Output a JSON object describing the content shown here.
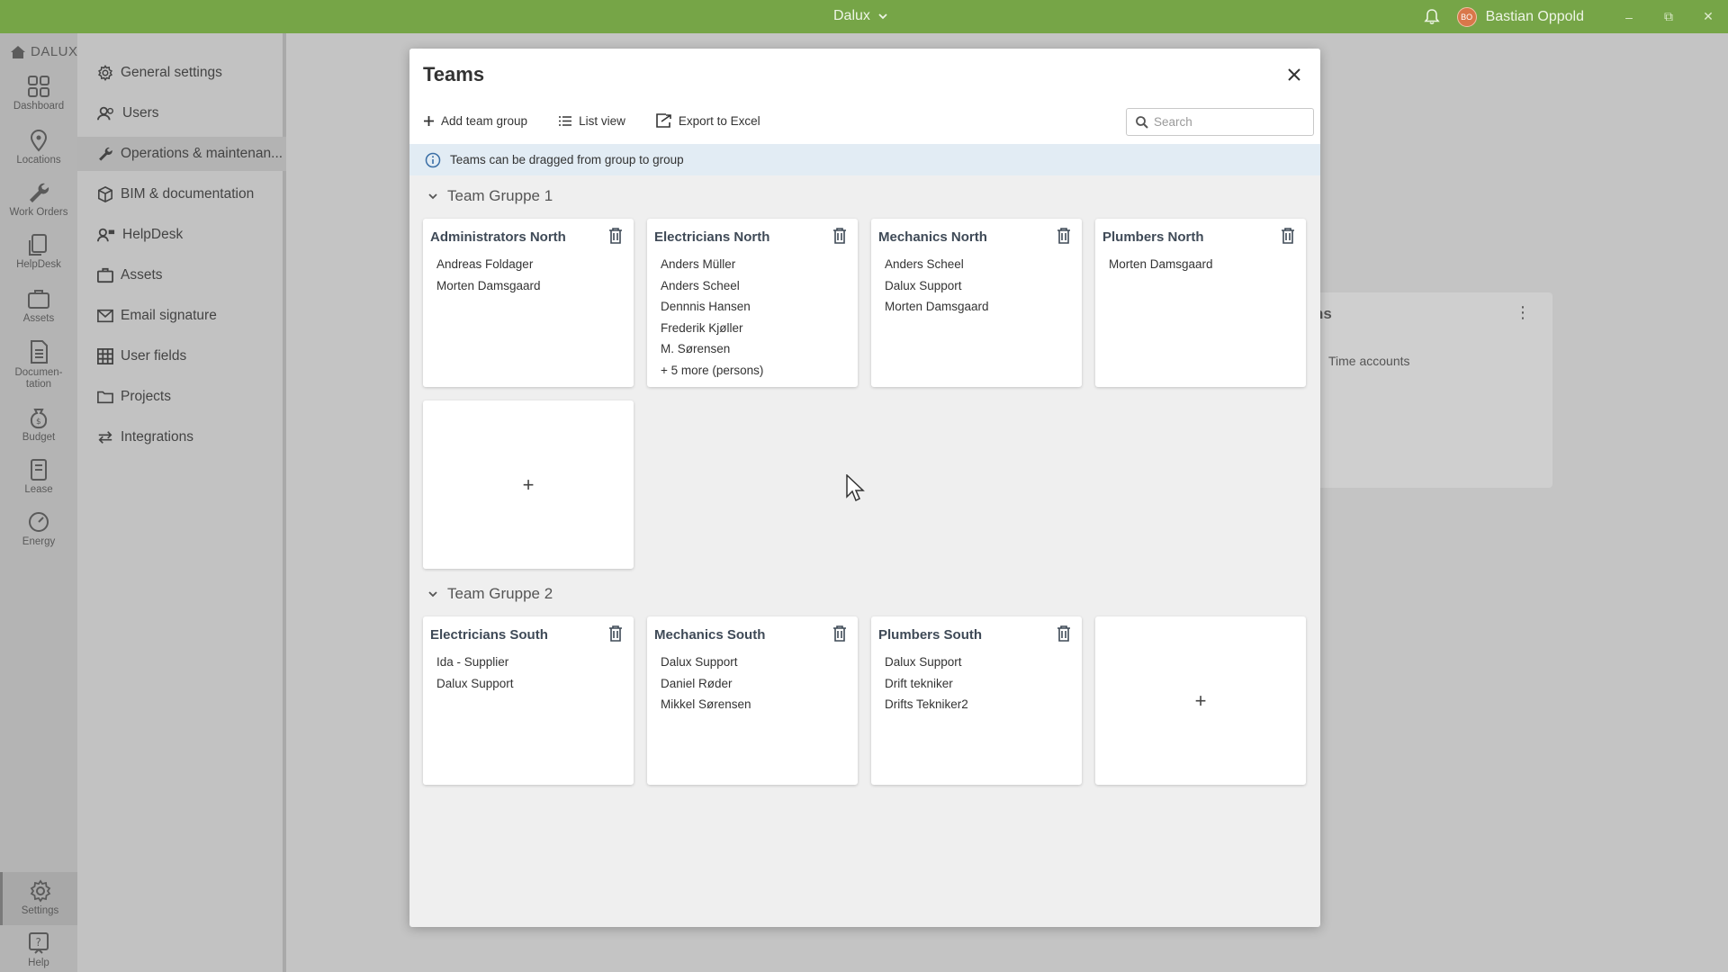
{
  "titlebar": {
    "app_name": "Dalux",
    "user_initials": "BO",
    "user_name": "Bastian Oppold"
  },
  "rail": {
    "logo_text": "DALUX",
    "items": [
      {
        "label": "Dashboard",
        "icon": "dashboard-icon"
      },
      {
        "label": "Locations",
        "icon": "location-pin-icon"
      },
      {
        "label": "Work Orders",
        "icon": "wrench-icon"
      },
      {
        "label": "HelpDesk",
        "icon": "helpdesk-icon"
      },
      {
        "label": "Assets",
        "icon": "assets-icon"
      },
      {
        "label": "Documen-\ntation",
        "icon": "document-icon"
      },
      {
        "label": "Budget",
        "icon": "money-bag-icon"
      },
      {
        "label": "Lease",
        "icon": "lease-icon"
      },
      {
        "label": "Energy",
        "icon": "gauge-icon"
      },
      {
        "label": "Settings",
        "icon": "gear-icon"
      },
      {
        "label": "Help",
        "icon": "help-icon"
      }
    ]
  },
  "menu": {
    "items": [
      {
        "label": "General settings",
        "icon": "gear-icon"
      },
      {
        "label": "Users",
        "icon": "users-icon"
      },
      {
        "label": "Operations & maintenan...",
        "icon": "wrench-icon"
      },
      {
        "label": "BIM & documentation",
        "icon": "cube-icon"
      },
      {
        "label": "HelpDesk",
        "icon": "helpdesk-icon"
      },
      {
        "label": "Assets",
        "icon": "briefcase-icon"
      },
      {
        "label": "Email signature",
        "icon": "mail-icon"
      },
      {
        "label": "User fields",
        "icon": "grid-icon"
      },
      {
        "label": "Projects",
        "icon": "folder-icon"
      },
      {
        "label": "Integrations",
        "icon": "swap-icon"
      }
    ]
  },
  "background_card": {
    "title_fragment": "ns",
    "item": "Time accounts"
  },
  "modal": {
    "title": "Teams",
    "toolbar": {
      "add_group": "Add team group",
      "list_view": "List view",
      "export": "Export to Excel"
    },
    "search_placeholder": "Search",
    "info": "Teams can be dragged from group to group",
    "groups": [
      {
        "name": "Team Gruppe 1",
        "teams": [
          {
            "name": "Administrators North",
            "members": [
              "Andreas Foldager",
              "Morten Damsgaard"
            ],
            "more": ""
          },
          {
            "name": "Electricians North",
            "members": [
              "Anders Müller",
              "Anders Scheel",
              "Dennnis Hansen",
              "Frederik Kjøller",
              "M. Sørensen"
            ],
            "more": "+ 5 more (persons)"
          },
          {
            "name": "Mechanics North",
            "members": [
              "Anders Scheel",
              "Dalux Support",
              "Morten Damsgaard"
            ],
            "more": ""
          },
          {
            "name": "Plumbers North",
            "members": [
              "Morten Damsgaard"
            ],
            "more": ""
          }
        ],
        "add_label": "+"
      },
      {
        "name": "Team Gruppe 2",
        "teams": [
          {
            "name": "Electricians South",
            "members": [
              "Ida - Supplier",
              "Dalux Support"
            ],
            "more": ""
          },
          {
            "name": "Mechanics South",
            "members": [
              "Dalux Support",
              "Daniel Røder",
              "Mikkel Sørensen"
            ],
            "more": ""
          },
          {
            "name": "Plumbers South",
            "members": [
              "Dalux Support",
              "Drift tekniker",
              "Drifts Tekniker2"
            ],
            "more": ""
          }
        ],
        "add_label": "+"
      }
    ]
  }
}
